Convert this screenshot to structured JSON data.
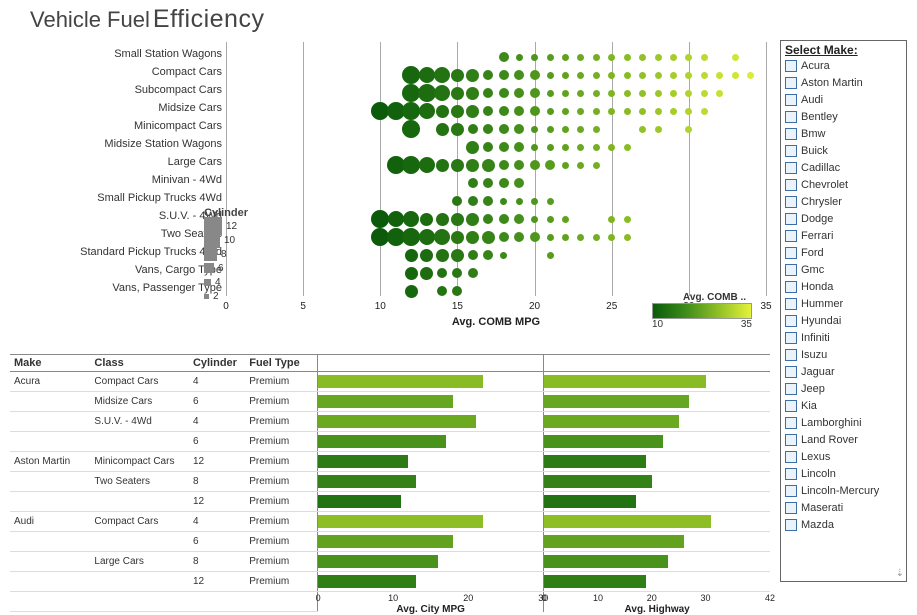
{
  "title": {
    "t1": "Vehicle Fuel",
    "t2": "Efficiency"
  },
  "bubble": {
    "x_title": "Avg. COMB MPG",
    "x_ticks": [
      0,
      5,
      10,
      15,
      20,
      25,
      30,
      35
    ],
    "categories": [
      "Small Station Wagons",
      "Compact Cars",
      "Subcompact Cars",
      "Midsize Cars",
      "Minicompact Cars",
      "Midsize Station Wagons",
      "Large Cars",
      "Minivan - 4Wd",
      "Small Pickup Trucks 4Wd",
      "S.U.V. - 4Wd",
      "Two Seaters",
      "Standard Pickup Trucks 4Wd",
      "Vans, Cargo Type",
      "Vans, Passenger Type"
    ]
  },
  "cyl_legend": {
    "title": "Cylinder",
    "vals": [
      12,
      10,
      8,
      6,
      4,
      2
    ]
  },
  "color_legend": {
    "title": "Avg. COMB ..",
    "min": 10,
    "max": 35
  },
  "table": {
    "headers": [
      "Make",
      "Class",
      "Cylinder",
      "Fuel Type"
    ],
    "bar_headers": [
      "",
      ""
    ],
    "axis1": {
      "title": "Avg. City MPG",
      "ticks": [
        0,
        10,
        20,
        30
      ],
      "max": 30
    },
    "axis2": {
      "title": "Avg. Highway",
      "ticks": [
        0,
        10,
        20,
        30,
        42
      ],
      "max": 42
    }
  },
  "filter": {
    "title": "Select Make:",
    "options": [
      "Acura",
      "Aston Martin",
      "Audi",
      "Bentley",
      "Bmw",
      "Buick",
      "Cadillac",
      "Chevrolet",
      "Chrysler",
      "Dodge",
      "Ferrari",
      "Ford",
      "Gmc",
      "Honda",
      "Hummer",
      "Hyundai",
      "Infiniti",
      "Isuzu",
      "Jaguar",
      "Jeep",
      "Kia",
      "Lamborghini",
      "Land Rover",
      "Lexus",
      "Lincoln",
      "Lincoln-Mercury",
      "Maserati",
      "Mazda"
    ]
  },
  "chart_data": {
    "bubble_chart": {
      "type": "scatter",
      "xlabel": "Avg. COMB MPG",
      "xlim": [
        0,
        35
      ],
      "size_encodes": "Cylinder",
      "color_encodes": "Avg. COMB MPG",
      "color_range": [
        10,
        35
      ],
      "series": [
        {
          "category": "Small Station Wagons",
          "points": [
            {
              "x": 18,
              "cyl": 6
            },
            {
              "x": 19,
              "cyl": 4
            },
            {
              "x": 20,
              "cyl": 4
            },
            {
              "x": 21,
              "cyl": 4
            },
            {
              "x": 22,
              "cyl": 4
            },
            {
              "x": 23,
              "cyl": 4
            },
            {
              "x": 24,
              "cyl": 4
            },
            {
              "x": 25,
              "cyl": 4
            },
            {
              "x": 26,
              "cyl": 4
            },
            {
              "x": 27,
              "cyl": 4
            },
            {
              "x": 28,
              "cyl": 4
            },
            {
              "x": 29,
              "cyl": 4
            },
            {
              "x": 30,
              "cyl": 4
            },
            {
              "x": 31,
              "cyl": 4
            },
            {
              "x": 33,
              "cyl": 4
            }
          ]
        },
        {
          "category": "Compact Cars",
          "points": [
            {
              "x": 12,
              "cyl": 12
            },
            {
              "x": 13,
              "cyl": 10
            },
            {
              "x": 14,
              "cyl": 10
            },
            {
              "x": 15,
              "cyl": 8
            },
            {
              "x": 16,
              "cyl": 8
            },
            {
              "x": 17,
              "cyl": 6
            },
            {
              "x": 18,
              "cyl": 6
            },
            {
              "x": 19,
              "cyl": 6
            },
            {
              "x": 20,
              "cyl": 6
            },
            {
              "x": 21,
              "cyl": 4
            },
            {
              "x": 22,
              "cyl": 4
            },
            {
              "x": 23,
              "cyl": 4
            },
            {
              "x": 24,
              "cyl": 4
            },
            {
              "x": 25,
              "cyl": 4
            },
            {
              "x": 26,
              "cyl": 4
            },
            {
              "x": 27,
              "cyl": 4
            },
            {
              "x": 28,
              "cyl": 4
            },
            {
              "x": 29,
              "cyl": 4
            },
            {
              "x": 30,
              "cyl": 4
            },
            {
              "x": 31,
              "cyl": 4
            },
            {
              "x": 32,
              "cyl": 4
            },
            {
              "x": 33,
              "cyl": 4
            },
            {
              "x": 34,
              "cyl": 4
            }
          ]
        },
        {
          "category": "Subcompact Cars",
          "points": [
            {
              "x": 12,
              "cyl": 12
            },
            {
              "x": 13,
              "cyl": 12
            },
            {
              "x": 14,
              "cyl": 10
            },
            {
              "x": 15,
              "cyl": 8
            },
            {
              "x": 16,
              "cyl": 8
            },
            {
              "x": 17,
              "cyl": 6
            },
            {
              "x": 18,
              "cyl": 6
            },
            {
              "x": 19,
              "cyl": 6
            },
            {
              "x": 20,
              "cyl": 6
            },
            {
              "x": 21,
              "cyl": 4
            },
            {
              "x": 22,
              "cyl": 4
            },
            {
              "x": 23,
              "cyl": 4
            },
            {
              "x": 24,
              "cyl": 4
            },
            {
              "x": 25,
              "cyl": 4
            },
            {
              "x": 26,
              "cyl": 4
            },
            {
              "x": 27,
              "cyl": 4
            },
            {
              "x": 28,
              "cyl": 4
            },
            {
              "x": 29,
              "cyl": 4
            },
            {
              "x": 30,
              "cyl": 4
            },
            {
              "x": 31,
              "cyl": 4
            },
            {
              "x": 32,
              "cyl": 4
            }
          ]
        },
        {
          "category": "Midsize Cars",
          "points": [
            {
              "x": 10,
              "cyl": 12
            },
            {
              "x": 11,
              "cyl": 12
            },
            {
              "x": 12,
              "cyl": 12
            },
            {
              "x": 13,
              "cyl": 10
            },
            {
              "x": 14,
              "cyl": 8
            },
            {
              "x": 15,
              "cyl": 8
            },
            {
              "x": 16,
              "cyl": 8
            },
            {
              "x": 17,
              "cyl": 6
            },
            {
              "x": 18,
              "cyl": 6
            },
            {
              "x": 19,
              "cyl": 6
            },
            {
              "x": 20,
              "cyl": 6
            },
            {
              "x": 21,
              "cyl": 4
            },
            {
              "x": 22,
              "cyl": 4
            },
            {
              "x": 23,
              "cyl": 4
            },
            {
              "x": 24,
              "cyl": 4
            },
            {
              "x": 25,
              "cyl": 4
            },
            {
              "x": 26,
              "cyl": 4
            },
            {
              "x": 27,
              "cyl": 4
            },
            {
              "x": 28,
              "cyl": 4
            },
            {
              "x": 29,
              "cyl": 4
            },
            {
              "x": 30,
              "cyl": 4
            },
            {
              "x": 31,
              "cyl": 4
            }
          ]
        },
        {
          "category": "Minicompact Cars",
          "points": [
            {
              "x": 12,
              "cyl": 12
            },
            {
              "x": 14,
              "cyl": 8
            },
            {
              "x": 15,
              "cyl": 8
            },
            {
              "x": 16,
              "cyl": 6
            },
            {
              "x": 17,
              "cyl": 6
            },
            {
              "x": 18,
              "cyl": 6
            },
            {
              "x": 19,
              "cyl": 6
            },
            {
              "x": 20,
              "cyl": 4
            },
            {
              "x": 21,
              "cyl": 4
            },
            {
              "x": 22,
              "cyl": 4
            },
            {
              "x": 23,
              "cyl": 4
            },
            {
              "x": 24,
              "cyl": 4
            },
            {
              "x": 27,
              "cyl": 4
            },
            {
              "x": 28,
              "cyl": 4
            },
            {
              "x": 30,
              "cyl": 4
            }
          ]
        },
        {
          "category": "Midsize Station Wagons",
          "points": [
            {
              "x": 16,
              "cyl": 8
            },
            {
              "x": 17,
              "cyl": 6
            },
            {
              "x": 18,
              "cyl": 6
            },
            {
              "x": 19,
              "cyl": 6
            },
            {
              "x": 20,
              "cyl": 4
            },
            {
              "x": 21,
              "cyl": 4
            },
            {
              "x": 22,
              "cyl": 4
            },
            {
              "x": 23,
              "cyl": 4
            },
            {
              "x": 24,
              "cyl": 4
            },
            {
              "x": 25,
              "cyl": 4
            },
            {
              "x": 26,
              "cyl": 4
            }
          ]
        },
        {
          "category": "Large Cars",
          "points": [
            {
              "x": 11,
              "cyl": 12
            },
            {
              "x": 12,
              "cyl": 12
            },
            {
              "x": 13,
              "cyl": 10
            },
            {
              "x": 14,
              "cyl": 8
            },
            {
              "x": 15,
              "cyl": 8
            },
            {
              "x": 16,
              "cyl": 8
            },
            {
              "x": 17,
              "cyl": 8
            },
            {
              "x": 18,
              "cyl": 6
            },
            {
              "x": 19,
              "cyl": 6
            },
            {
              "x": 20,
              "cyl": 6
            },
            {
              "x": 21,
              "cyl": 6
            },
            {
              "x": 22,
              "cyl": 4
            },
            {
              "x": 23,
              "cyl": 4
            },
            {
              "x": 24,
              "cyl": 4
            }
          ]
        },
        {
          "category": "Minivan - 4Wd",
          "points": [
            {
              "x": 16,
              "cyl": 6
            },
            {
              "x": 17,
              "cyl": 6
            },
            {
              "x": 18,
              "cyl": 6
            },
            {
              "x": 19,
              "cyl": 6
            }
          ]
        },
        {
          "category": "Small Pickup Trucks 4Wd",
          "points": [
            {
              "x": 15,
              "cyl": 6
            },
            {
              "x": 16,
              "cyl": 6
            },
            {
              "x": 17,
              "cyl": 6
            },
            {
              "x": 18,
              "cyl": 4
            },
            {
              "x": 19,
              "cyl": 4
            },
            {
              "x": 20,
              "cyl": 4
            },
            {
              "x": 21,
              "cyl": 4
            }
          ]
        },
        {
          "category": "S.U.V. - 4Wd",
          "points": [
            {
              "x": 10,
              "cyl": 12
            },
            {
              "x": 11,
              "cyl": 10
            },
            {
              "x": 12,
              "cyl": 10
            },
            {
              "x": 13,
              "cyl": 8
            },
            {
              "x": 14,
              "cyl": 8
            },
            {
              "x": 15,
              "cyl": 8
            },
            {
              "x": 16,
              "cyl": 8
            },
            {
              "x": 17,
              "cyl": 6
            },
            {
              "x": 18,
              "cyl": 6
            },
            {
              "x": 19,
              "cyl": 6
            },
            {
              "x": 20,
              "cyl": 4
            },
            {
              "x": 21,
              "cyl": 4
            },
            {
              "x": 22,
              "cyl": 4
            },
            {
              "x": 25,
              "cyl": 4
            },
            {
              "x": 26,
              "cyl": 4
            }
          ]
        },
        {
          "category": "Two Seaters",
          "points": [
            {
              "x": 10,
              "cyl": 12
            },
            {
              "x": 11,
              "cyl": 12
            },
            {
              "x": 12,
              "cyl": 12
            },
            {
              "x": 13,
              "cyl": 10
            },
            {
              "x": 14,
              "cyl": 10
            },
            {
              "x": 15,
              "cyl": 8
            },
            {
              "x": 16,
              "cyl": 8
            },
            {
              "x": 17,
              "cyl": 8
            },
            {
              "x": 18,
              "cyl": 6
            },
            {
              "x": 19,
              "cyl": 6
            },
            {
              "x": 20,
              "cyl": 6
            },
            {
              "x": 21,
              "cyl": 4
            },
            {
              "x": 22,
              "cyl": 4
            },
            {
              "x": 23,
              "cyl": 4
            },
            {
              "x": 24,
              "cyl": 4
            },
            {
              "x": 25,
              "cyl": 4
            },
            {
              "x": 26,
              "cyl": 4
            }
          ]
        },
        {
          "category": "Standard Pickup Trucks 4Wd",
          "points": [
            {
              "x": 12,
              "cyl": 8
            },
            {
              "x": 13,
              "cyl": 8
            },
            {
              "x": 14,
              "cyl": 8
            },
            {
              "x": 15,
              "cyl": 8
            },
            {
              "x": 16,
              "cyl": 6
            },
            {
              "x": 17,
              "cyl": 6
            },
            {
              "x": 18,
              "cyl": 4
            },
            {
              "x": 21,
              "cyl": 4
            }
          ]
        },
        {
          "category": "Vans, Cargo Type",
          "points": [
            {
              "x": 12,
              "cyl": 8
            },
            {
              "x": 13,
              "cyl": 8
            },
            {
              "x": 14,
              "cyl": 6
            },
            {
              "x": 15,
              "cyl": 6
            },
            {
              "x": 16,
              "cyl": 6
            }
          ]
        },
        {
          "category": "Vans, Passenger Type",
          "points": [
            {
              "x": 12,
              "cyl": 8
            },
            {
              "x": 14,
              "cyl": 6
            },
            {
              "x": 15,
              "cyl": 6
            }
          ]
        }
      ]
    },
    "bar_charts": {
      "type": "bar",
      "metrics": [
        "Avg. City MPG",
        "Avg. Highway"
      ],
      "rows": [
        {
          "make": "Acura",
          "class": "Compact Cars",
          "cyl": 4,
          "fuel": "Premium",
          "city": 22,
          "hwy": 30
        },
        {
          "make": "Acura",
          "class": "Midsize Cars",
          "cyl": 6,
          "fuel": "Premium",
          "city": 18,
          "hwy": 27
        },
        {
          "make": "Acura",
          "class": "S.U.V. - 4Wd",
          "cyl": 4,
          "fuel": "Premium",
          "city": 21,
          "hwy": 25
        },
        {
          "make": "Acura",
          "class": "S.U.V. - 4Wd",
          "cyl": 6,
          "fuel": "Premium",
          "city": 17,
          "hwy": 22
        },
        {
          "make": "Aston Martin",
          "class": "Minicompact Cars",
          "cyl": 12,
          "fuel": "Premium",
          "city": 12,
          "hwy": 19
        },
        {
          "make": "Aston Martin",
          "class": "Two Seaters",
          "cyl": 8,
          "fuel": "Premium",
          "city": 13,
          "hwy": 20
        },
        {
          "make": "Aston Martin",
          "class": "Two Seaters",
          "cyl": 12,
          "fuel": "Premium",
          "city": 11,
          "hwy": 17
        },
        {
          "make": "Audi",
          "class": "Compact Cars",
          "cyl": 4,
          "fuel": "Premium",
          "city": 22,
          "hwy": 31
        },
        {
          "make": "Audi",
          "class": "Compact Cars",
          "cyl": 6,
          "fuel": "Premium",
          "city": 18,
          "hwy": 26
        },
        {
          "make": "Audi",
          "class": "Large Cars",
          "cyl": 8,
          "fuel": "Premium",
          "city": 16,
          "hwy": 23
        },
        {
          "make": "Audi",
          "class": "Large Cars",
          "cyl": 12,
          "fuel": "Premium",
          "city": 13,
          "hwy": 19
        }
      ]
    }
  }
}
